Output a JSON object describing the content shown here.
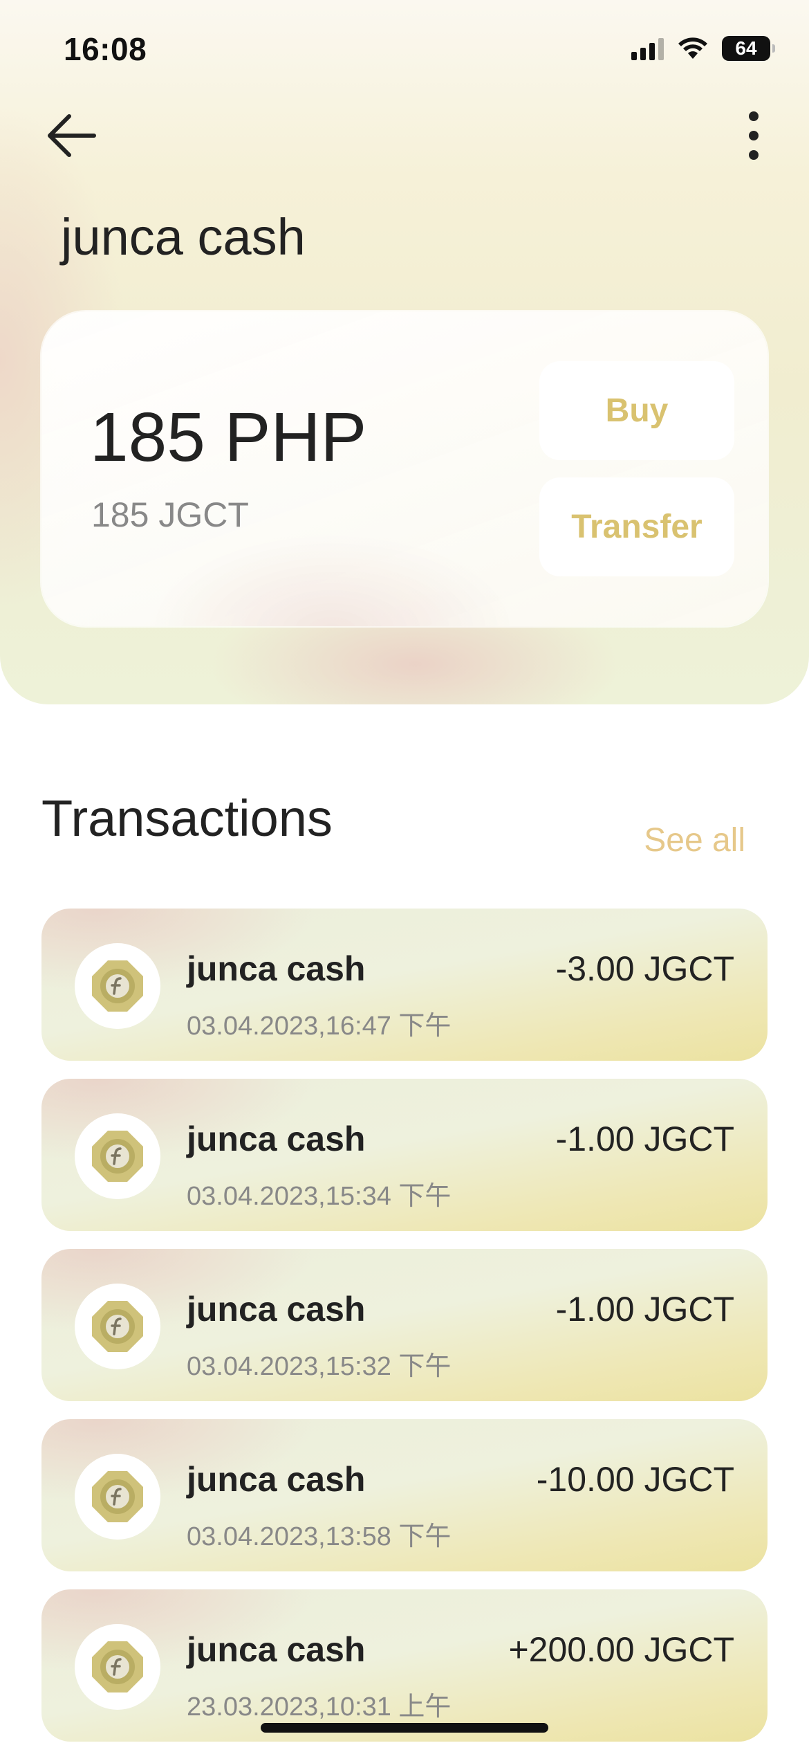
{
  "status_bar": {
    "time": "16:08",
    "battery": "64"
  },
  "header": {
    "title": "junca cash"
  },
  "balance": {
    "amount": "185 PHP",
    "sub_amount": "185 JGCT",
    "buy_label": "Buy",
    "transfer_label": "Transfer"
  },
  "transactions": {
    "title": "Transactions",
    "see_all_label": "See all",
    "items": [
      {
        "name": "junca cash",
        "date": "03.04.2023,16:47 下午",
        "amount": "-3.00 JGCT"
      },
      {
        "name": "junca cash",
        "date": "03.04.2023,15:34 下午",
        "amount": "-1.00 JGCT"
      },
      {
        "name": "junca cash",
        "date": "03.04.2023,15:32 下午",
        "amount": "-1.00 JGCT"
      },
      {
        "name": "junca cash",
        "date": "03.04.2023,13:58 下午",
        "amount": "-10.00 JGCT"
      },
      {
        "name": "junca cash",
        "date": "23.03.2023,10:31 上午",
        "amount": "+200.00 JGCT"
      }
    ]
  },
  "colors": {
    "accent": "#d9c270",
    "see_all": "#e6c88a",
    "coin_outer": "#cfc27a",
    "coin_inner": "#b9ad63"
  },
  "icons": {
    "back": "arrow-left-icon",
    "more": "vertical-dots-icon",
    "coin": "coin-icon"
  }
}
